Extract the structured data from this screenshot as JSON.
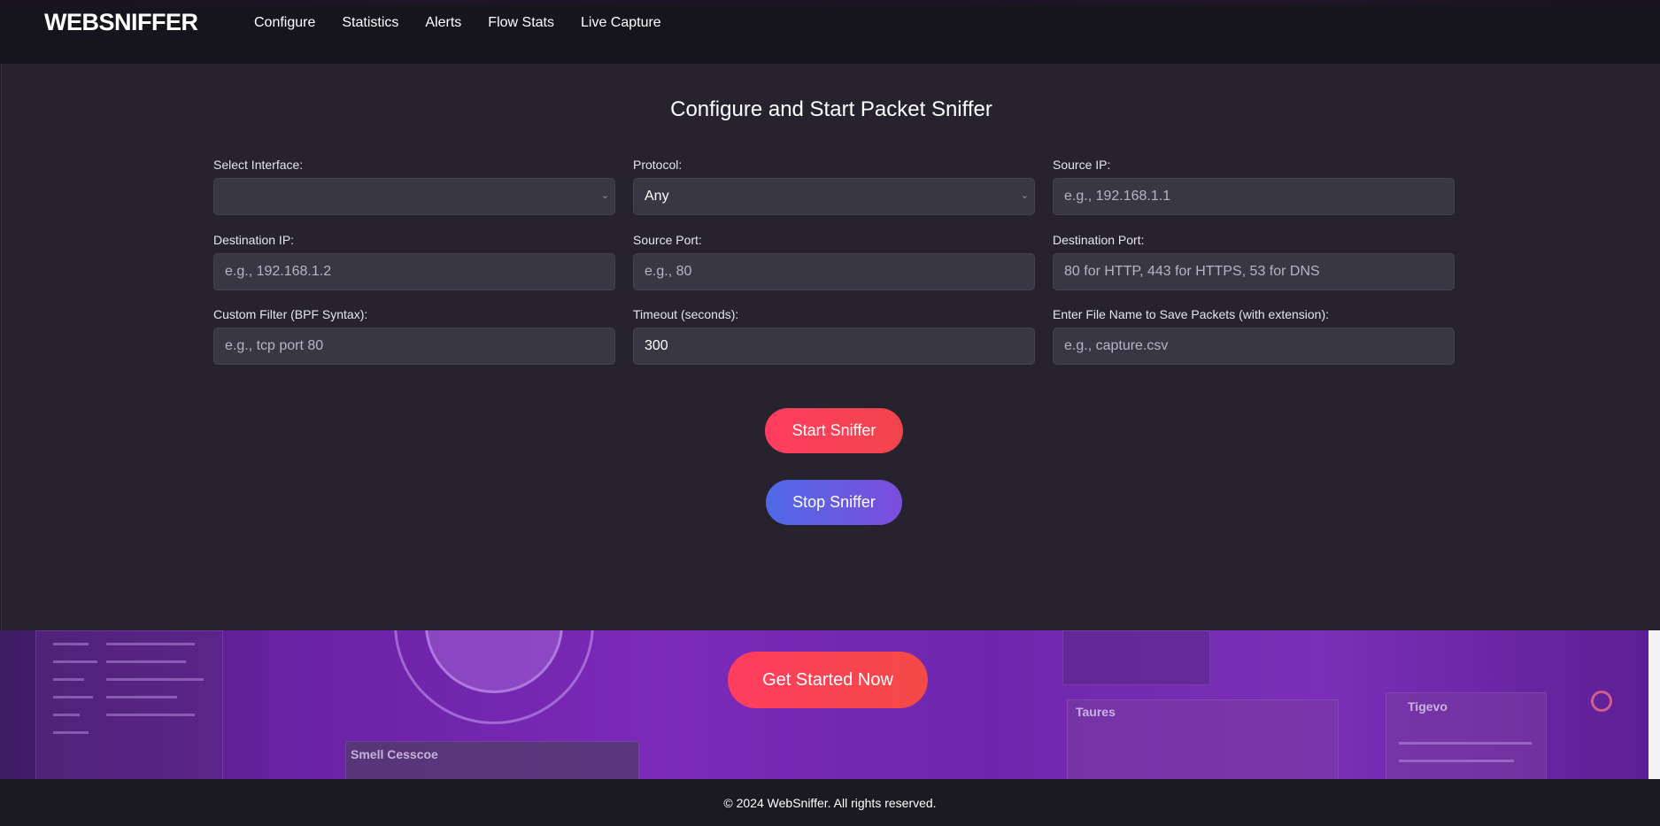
{
  "brand": "WEBSNIFFER",
  "nav": {
    "items": [
      "Configure",
      "Statistics",
      "Alerts",
      "Flow Stats",
      "Live Capture"
    ]
  },
  "panel": {
    "title": "Configure and Start Packet Sniffer",
    "fields": {
      "interface": {
        "label": "Select Interface:",
        "value": ""
      },
      "protocol": {
        "label": "Protocol:",
        "value": "Any"
      },
      "source_ip": {
        "label": "Source IP:",
        "placeholder": "e.g., 192.168.1.1"
      },
      "destination_ip": {
        "label": "Destination IP:",
        "placeholder": "e.g., 192.168.1.2"
      },
      "source_port": {
        "label": "Source Port:",
        "placeholder": "e.g., 80"
      },
      "destination_port": {
        "label": "Destination Port:",
        "placeholder": "80 for HTTP, 443 for HTTPS, 53 for DNS"
      },
      "custom_filter": {
        "label": "Custom Filter (BPF Syntax):",
        "placeholder": "e.g., tcp port 80"
      },
      "timeout": {
        "label": "Timeout (seconds):",
        "value": "300"
      },
      "file_name": {
        "label": "Enter File Name to Save Packets (with extension):",
        "placeholder": "e.g., capture.csv"
      }
    },
    "start_button": "Start Sniffer",
    "stop_button": "Stop Sniffer"
  },
  "hero": {
    "cta": "Get Started Now",
    "deco_labels": [
      "Smell Cesscoe",
      "Taures",
      "Tigevo"
    ]
  },
  "footer": {
    "copyright": "© 2024 WebSniffer. All rights reserved."
  },
  "colors": {
    "accent_red": "#ff3d5f",
    "accent_blue": "#4f6ae6",
    "accent_purple": "#7c4ddc",
    "panel_bg": "#26232f",
    "input_bg": "#3a3744"
  }
}
